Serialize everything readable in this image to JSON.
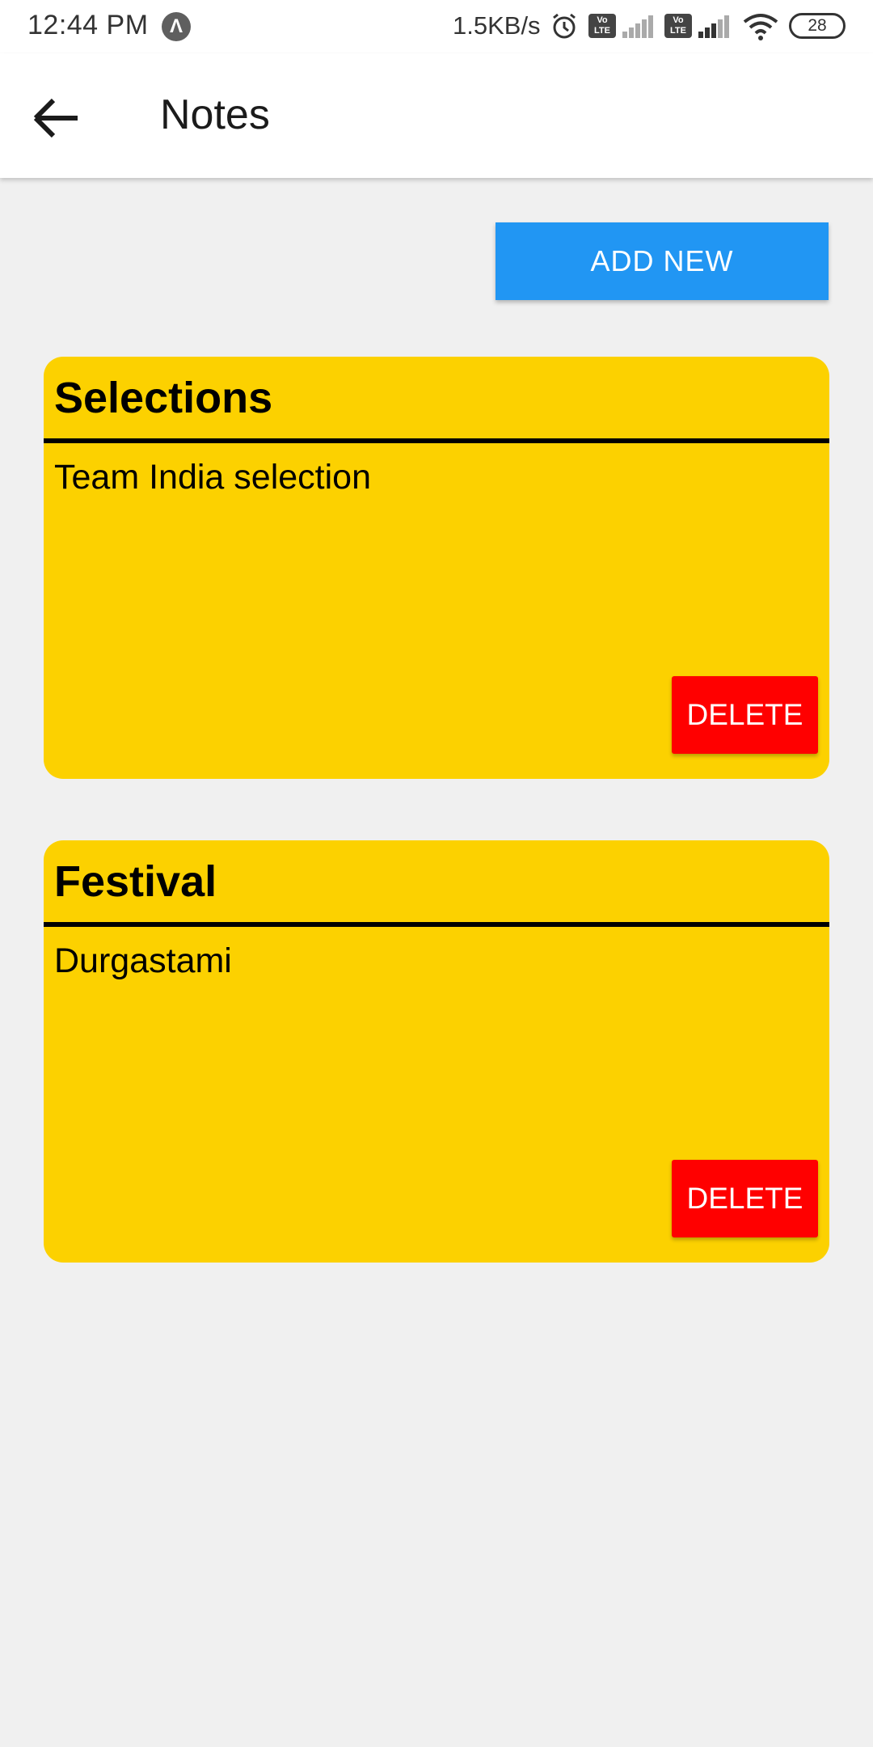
{
  "status_bar": {
    "time": "12:44 PM",
    "app_icon": "Λ",
    "network_speed": "1.5KB/s",
    "volte_label": "Vo LTE",
    "battery": "28",
    "icons": [
      "alarm-icon",
      "volte-icon",
      "signal-icon",
      "wifi-icon",
      "battery-icon"
    ]
  },
  "header": {
    "title": "Notes",
    "back_icon": "arrow-left-icon"
  },
  "actions": {
    "add_label": "ADD NEW"
  },
  "notes": [
    {
      "title": "Selections",
      "body": "Team India selection",
      "delete_label": "DELETE"
    },
    {
      "title": "Festival",
      "body": "Durgastami",
      "delete_label": "DELETE"
    }
  ],
  "colors": {
    "primary": "#2196f3",
    "note_background": "#fcd100",
    "delete": "#ff0000",
    "page_background": "#f0f0f0"
  }
}
